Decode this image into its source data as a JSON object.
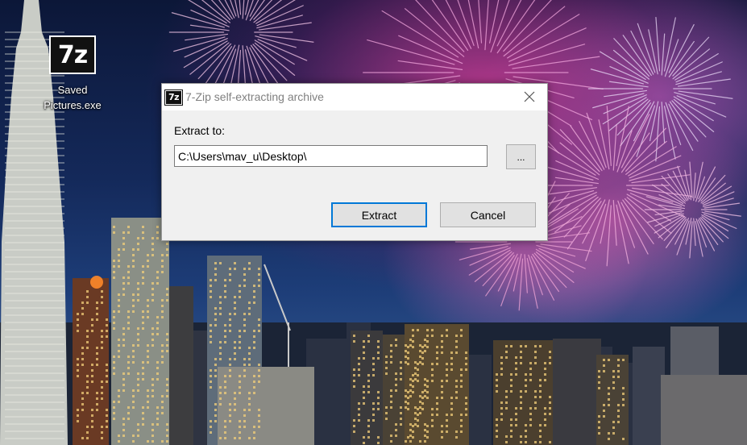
{
  "desktop": {
    "icon": {
      "logo_text": "7z",
      "label_line1": "Saved",
      "label_line2": "Pictures.exe"
    }
  },
  "dialog": {
    "title_icon_text": "7z",
    "title": "7-Zip self-extracting archive",
    "extract_label": "Extract to:",
    "path_value": "C:\\Users\\mav_u\\Desktop\\",
    "browse_label": "...",
    "extract_button": "Extract",
    "cancel_button": "Cancel",
    "icons": {
      "close": "close-icon",
      "app": "7zip-icon"
    }
  },
  "colors": {
    "focus_border": "#0078d7",
    "dialog_bg": "#f0f0f0",
    "title_text": "#808080",
    "button_bg": "#e1e1e1"
  }
}
